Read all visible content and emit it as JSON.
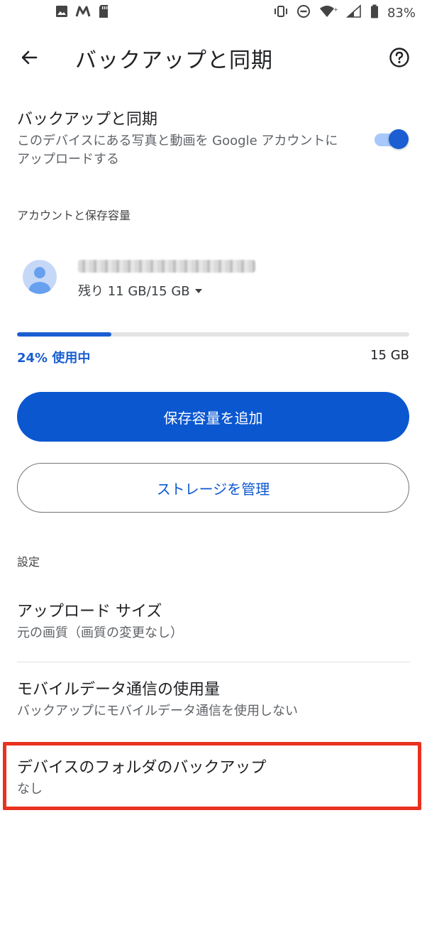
{
  "status_bar": {
    "battery_percent": "83%",
    "left_icons": [
      "image-icon",
      "m-logo-icon",
      "sd-card-icon"
    ],
    "right_icons": [
      "vibrate-icon",
      "do-not-disturb-icon",
      "wifi-icon",
      "signal-icon",
      "battery-icon"
    ]
  },
  "app_bar": {
    "title": "バックアップと同期"
  },
  "backup_sync": {
    "title": "バックアップと同期",
    "description": "このデバイスにある写真と動画を Google アカウントにアップロードする",
    "enabled": true
  },
  "account_section": {
    "header": "アカウントと保存容量",
    "quota_remaining": "残り 11 GB/15 GB",
    "usage_fraction": 0.24,
    "usage_label": "24% 使用中",
    "total_label": "15 GB"
  },
  "buttons": {
    "add_storage": "保存容量を追加",
    "manage_storage": "ストレージを管理"
  },
  "settings_section": {
    "header": "設定",
    "items": [
      {
        "title": "アップロード サイズ",
        "subtitle": "元の画質（画質の変更なし）"
      },
      {
        "title": "モバイルデータ通信の使用量",
        "subtitle": "バックアップにモバイルデータ通信を使用しない"
      },
      {
        "title": "デバイスのフォルダのバックアップ",
        "subtitle": "なし"
      }
    ]
  },
  "colors": {
    "accent": "#0b57d0",
    "highlight": "#e8321f"
  }
}
